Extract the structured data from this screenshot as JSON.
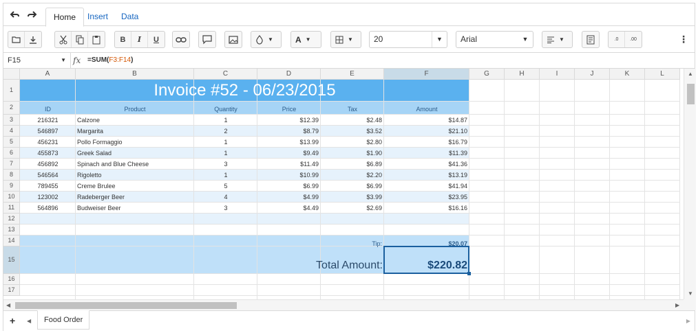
{
  "tabs": [
    {
      "label": "Home"
    },
    {
      "label": "Insert"
    },
    {
      "label": "Data"
    }
  ],
  "toolbar": {
    "font_size": "20",
    "font_family": "Arial",
    "text_color_label": "A"
  },
  "formula_bar": {
    "cell_ref": "F15",
    "fx_label": "fx",
    "formula_prefix": "=SUM(",
    "formula_range": "F3:F14",
    "formula_suffix": ")"
  },
  "columns": [
    "A",
    "B",
    "C",
    "D",
    "E",
    "F",
    "G",
    "H",
    "I",
    "J",
    "K",
    "L"
  ],
  "rows": [
    "1",
    "2",
    "3",
    "4",
    "5",
    "6",
    "7",
    "8",
    "9",
    "10",
    "11",
    "12",
    "13",
    "14",
    "15",
    "16",
    "17"
  ],
  "invoice": {
    "title": "Invoice #52 - 06/23/2015",
    "headers": [
      "ID",
      "Product",
      "Quantity",
      "Price",
      "Tax",
      "Amount"
    ],
    "items": [
      {
        "id": "216321",
        "product": "Calzone",
        "qty": "1",
        "price": "$12.39",
        "tax": "$2.48",
        "amount": "$14.87"
      },
      {
        "id": "546897",
        "product": "Margarita",
        "qty": "2",
        "price": "$8.79",
        "tax": "$3.52",
        "amount": "$21.10"
      },
      {
        "id": "456231",
        "product": "Pollo Formaggio",
        "qty": "1",
        "price": "$13.99",
        "tax": "$2.80",
        "amount": "$16.79"
      },
      {
        "id": "455873",
        "product": "Greek Salad",
        "qty": "1",
        "price": "$9.49",
        "tax": "$1.90",
        "amount": "$11.39"
      },
      {
        "id": "456892",
        "product": "Spinach and Blue Cheese",
        "qty": "3",
        "price": "$11.49",
        "tax": "$6.89",
        "amount": "$41.36"
      },
      {
        "id": "546564",
        "product": "Rigoletto",
        "qty": "1",
        "price": "$10.99",
        "tax": "$2.20",
        "amount": "$13.19"
      },
      {
        "id": "789455",
        "product": "Creme Brulee",
        "qty": "5",
        "price": "$6.99",
        "tax": "$6.99",
        "amount": "$41.94"
      },
      {
        "id": "123002",
        "product": "Radeberger Beer",
        "qty": "4",
        "price": "$4.99",
        "tax": "$3.99",
        "amount": "$23.95"
      },
      {
        "id": "564896",
        "product": "Budweiser Beer",
        "qty": "3",
        "price": "$4.49",
        "tax": "$2.69",
        "amount": "$16.16"
      }
    ],
    "tip_label": "Tip:",
    "tip_value": "$20.07",
    "total_label": "Total Amount:",
    "total_value": "$220.82"
  },
  "sheets": [
    {
      "label": "Food Order"
    }
  ],
  "colors": {
    "title_band": "#5ab1ef",
    "header_band": "#a6d4f6",
    "stripe": "#e6f2fc",
    "total_band": "#bfe0f9",
    "selection": "#1a5f9e"
  }
}
